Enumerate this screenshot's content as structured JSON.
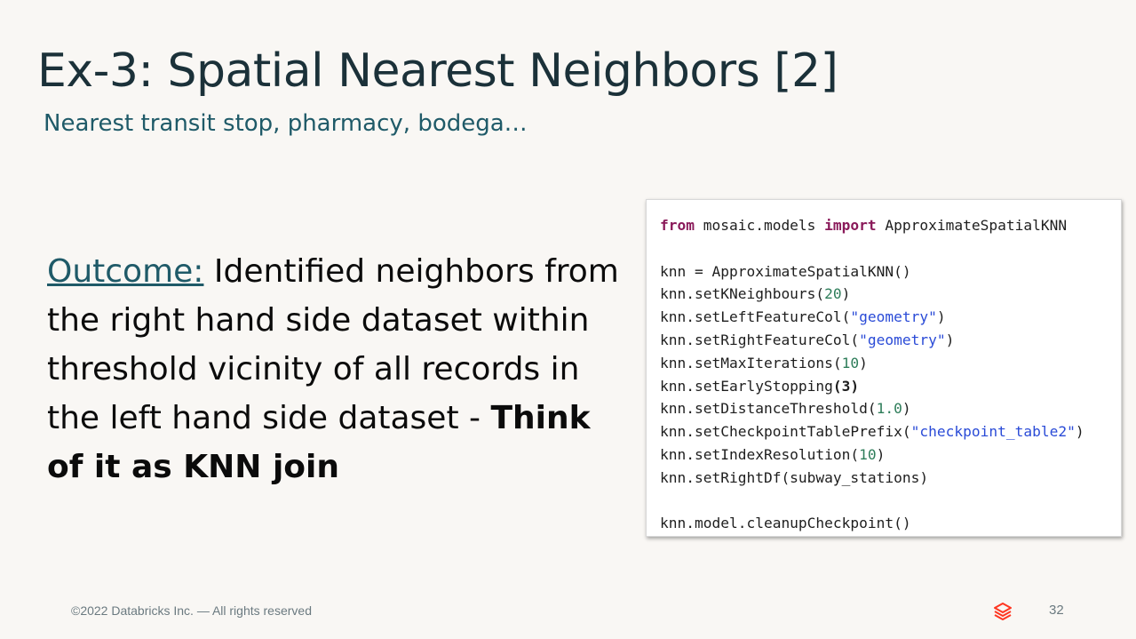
{
  "slide": {
    "title": "Ex-3: Spatial Nearest Neighbors [2]",
    "subtitle": "Nearest transit stop, pharmacy, bodega…",
    "body": {
      "outcome_label": "Outcome:",
      "text": " Identified neighbors from the right hand side dataset within threshold vicinity of all records in the left hand side dataset - ",
      "bold": "Think of it as KNN join"
    },
    "code": {
      "lines": [
        "from mosaic.models import ApproximateSpatialKNN",
        "",
        "knn = ApproximateSpatialKNN()",
        "knn.setKNeighbours(20)",
        "knn.setLeftFeatureCol(\"geometry\")",
        "knn.setRightFeatureCol(\"geometry\")",
        "knn.setMaxIterations(10)",
        "knn.setEarlyStopping(3)",
        "knn.setDistanceThreshold(1.0)",
        "knn.setCheckpointTablePrefix(\"checkpoint_table2\")",
        "knn.setIndexResolution(10)",
        "knn.setRightDf(subway_stations)",
        "",
        "knn.model.cleanupCheckpoint()"
      ]
    },
    "footer": "©2022 Databricks Inc. — All rights reserved",
    "page_number": "32",
    "logo_icon": "databricks-logo-icon",
    "colors": {
      "title": "#1b3139",
      "subtitle": "#1f5a68",
      "keyword": "#8a1a5a",
      "string": "#2a4bd7",
      "number": "#2e7d5a",
      "logo": "#ff3621"
    }
  }
}
